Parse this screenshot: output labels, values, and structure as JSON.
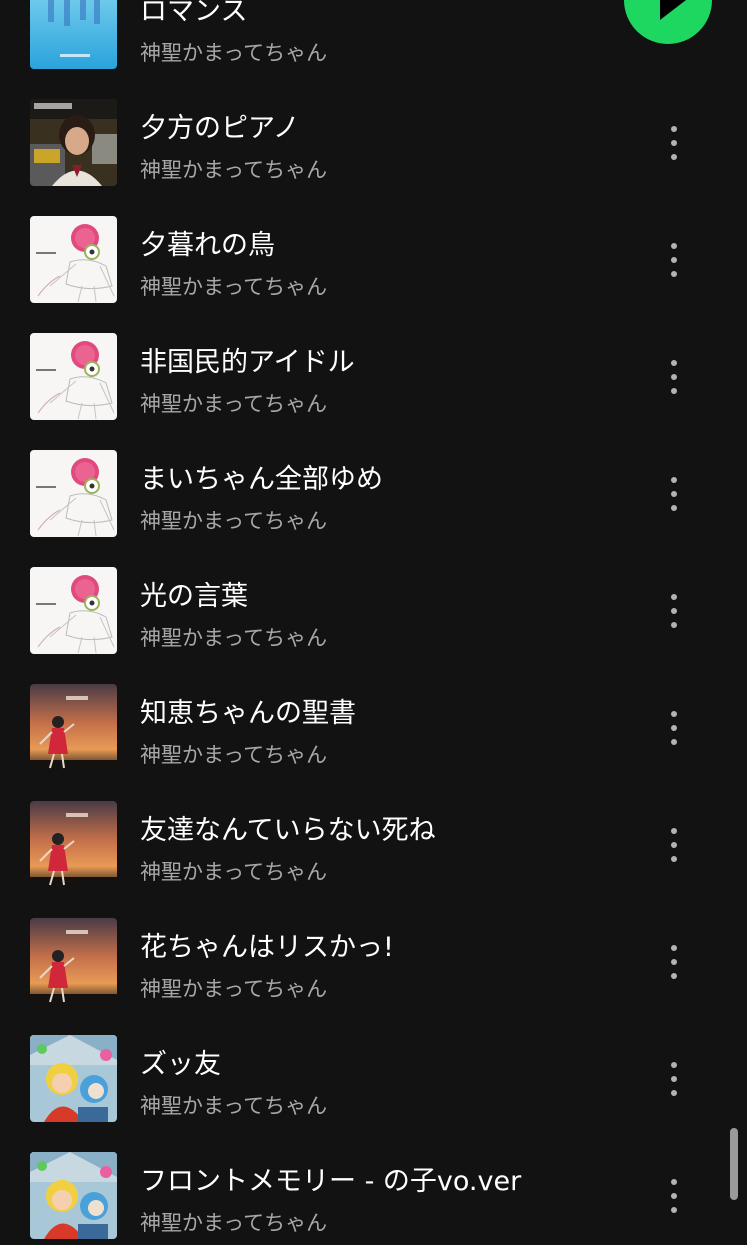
{
  "colors": {
    "background": "#121212",
    "title_text": "#ffffff",
    "artist_text": "#a7a7a7",
    "accent_green": "#1ed760"
  },
  "play_button": {
    "icon": "play-icon"
  },
  "tracks": [
    {
      "title": "ロマンス",
      "artist": "神聖かまってちゃん",
      "cover_style": "romance-blue"
    },
    {
      "title": "夕方のピアノ",
      "artist": "神聖かまってちゃん",
      "cover_style": "evening-piano-photo"
    },
    {
      "title": "夕暮れの鳥",
      "artist": "神聖かまってちゃん",
      "cover_style": "white-sketch-girl"
    },
    {
      "title": "非国民的アイドル",
      "artist": "神聖かまってちゃん",
      "cover_style": "white-sketch-girl"
    },
    {
      "title": "まいちゃん全部ゆめ",
      "artist": "神聖かまってちゃん",
      "cover_style": "white-sketch-girl"
    },
    {
      "title": "光の言葉",
      "artist": "神聖かまってちゃん",
      "cover_style": "white-sketch-girl"
    },
    {
      "title": "知恵ちゃんの聖書",
      "artist": "神聖かまってちゃん",
      "cover_style": "sunset-girl"
    },
    {
      "title": "友達なんていらない死ね",
      "artist": "神聖かまってちゃん",
      "cover_style": "sunset-girl"
    },
    {
      "title": "花ちゃんはリスかっ!",
      "artist": "神聖かまってちゃん",
      "cover_style": "sunset-girl"
    },
    {
      "title": "ズッ友",
      "artist": "神聖かまってちゃん",
      "cover_style": "colorful-anime"
    },
    {
      "title": "フロントメモリー - の子vo.ver",
      "artist": "神聖かまってちゃん",
      "cover_style": "colorful-anime"
    }
  ]
}
